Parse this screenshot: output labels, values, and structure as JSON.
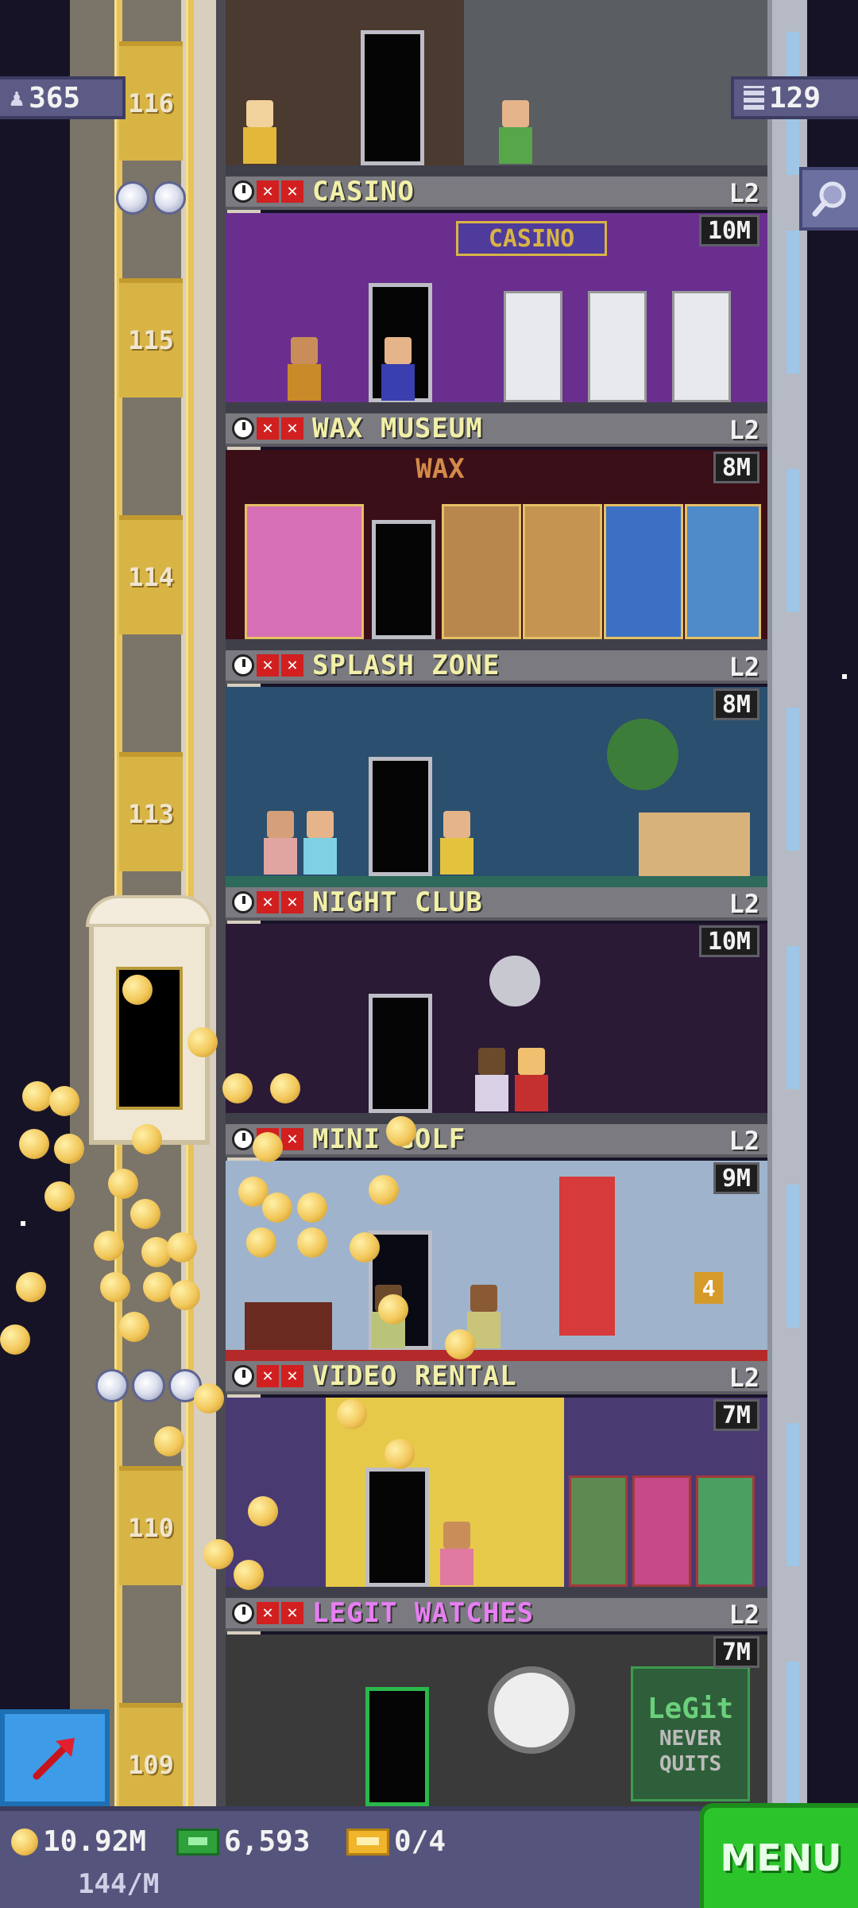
{
  "hud": {
    "population": "365",
    "floor_count": "129",
    "coins": "10.92M",
    "coin_rate": "144/M",
    "tower_bux": "6,593",
    "tickets": "0/4",
    "menu_label": "MENU"
  },
  "floors": [
    {
      "number": "116"
    },
    {
      "number": "115"
    },
    {
      "number": "114"
    },
    {
      "number": "113"
    },
    {
      "number": "110"
    },
    {
      "number": "109"
    }
  ],
  "rooms": [
    {
      "name": "CASINO",
      "level": "L2",
      "earnings": "10M"
    },
    {
      "name": "WAX MUSEUM",
      "level": "L2",
      "earnings": "8M",
      "sign": "WAX"
    },
    {
      "name": "SPLASH ZONE",
      "level": "L2",
      "earnings": "8M"
    },
    {
      "name": "NIGHT CLUB",
      "level": "L2",
      "earnings": "10M"
    },
    {
      "name": "MINI GOLF",
      "level": "L2",
      "earnings": "9M"
    },
    {
      "name": "VIDEO RENTAL",
      "level": "L2",
      "earnings": "7M"
    },
    {
      "name": "LEGIT WATCHES",
      "level": "L2",
      "earnings": "7M"
    }
  ],
  "signs": {
    "casino": "CASINO",
    "watch_brand": "LeGit",
    "watch_slogan_1": "NEVER",
    "watch_slogan_2": "QUITS",
    "golf_hole": "4"
  },
  "icons": [
    "person-icon",
    "floors-icon",
    "search-icon",
    "clock-icon",
    "x-icon",
    "coin-icon",
    "bux-icon",
    "ticket-icon",
    "build-arrow-icon",
    "star-icon"
  ],
  "colors": {
    "sky": "#171327",
    "room_name": "#f2f0a8",
    "room_name_special": "#e87ff3",
    "menu_button": "#2bc52b",
    "build_button": "#3d9be8"
  }
}
